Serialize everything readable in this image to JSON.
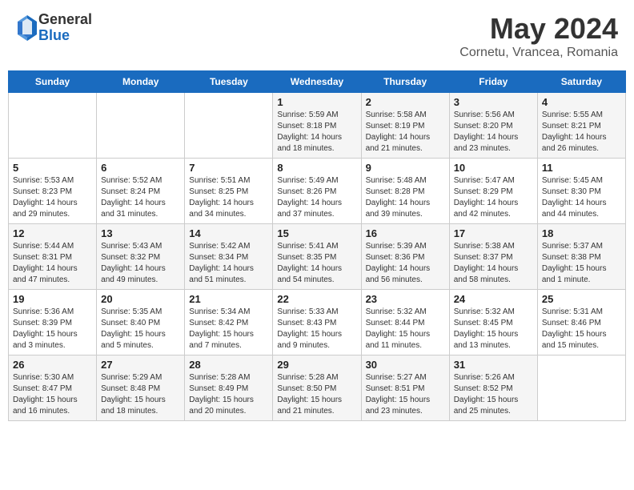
{
  "header": {
    "logo_general": "General",
    "logo_blue": "Blue",
    "month_title": "May 2024",
    "location": "Cornetu, Vrancea, Romania"
  },
  "weekdays": [
    "Sunday",
    "Monday",
    "Tuesday",
    "Wednesday",
    "Thursday",
    "Friday",
    "Saturday"
  ],
  "weeks": [
    [
      {
        "day": "",
        "info": ""
      },
      {
        "day": "",
        "info": ""
      },
      {
        "day": "",
        "info": ""
      },
      {
        "day": "1",
        "info": "Sunrise: 5:59 AM\nSunset: 8:18 PM\nDaylight: 14 hours\nand 18 minutes."
      },
      {
        "day": "2",
        "info": "Sunrise: 5:58 AM\nSunset: 8:19 PM\nDaylight: 14 hours\nand 21 minutes."
      },
      {
        "day": "3",
        "info": "Sunrise: 5:56 AM\nSunset: 8:20 PM\nDaylight: 14 hours\nand 23 minutes."
      },
      {
        "day": "4",
        "info": "Sunrise: 5:55 AM\nSunset: 8:21 PM\nDaylight: 14 hours\nand 26 minutes."
      }
    ],
    [
      {
        "day": "5",
        "info": "Sunrise: 5:53 AM\nSunset: 8:23 PM\nDaylight: 14 hours\nand 29 minutes."
      },
      {
        "day": "6",
        "info": "Sunrise: 5:52 AM\nSunset: 8:24 PM\nDaylight: 14 hours\nand 31 minutes."
      },
      {
        "day": "7",
        "info": "Sunrise: 5:51 AM\nSunset: 8:25 PM\nDaylight: 14 hours\nand 34 minutes."
      },
      {
        "day": "8",
        "info": "Sunrise: 5:49 AM\nSunset: 8:26 PM\nDaylight: 14 hours\nand 37 minutes."
      },
      {
        "day": "9",
        "info": "Sunrise: 5:48 AM\nSunset: 8:28 PM\nDaylight: 14 hours\nand 39 minutes."
      },
      {
        "day": "10",
        "info": "Sunrise: 5:47 AM\nSunset: 8:29 PM\nDaylight: 14 hours\nand 42 minutes."
      },
      {
        "day": "11",
        "info": "Sunrise: 5:45 AM\nSunset: 8:30 PM\nDaylight: 14 hours\nand 44 minutes."
      }
    ],
    [
      {
        "day": "12",
        "info": "Sunrise: 5:44 AM\nSunset: 8:31 PM\nDaylight: 14 hours\nand 47 minutes."
      },
      {
        "day": "13",
        "info": "Sunrise: 5:43 AM\nSunset: 8:32 PM\nDaylight: 14 hours\nand 49 minutes."
      },
      {
        "day": "14",
        "info": "Sunrise: 5:42 AM\nSunset: 8:34 PM\nDaylight: 14 hours\nand 51 minutes."
      },
      {
        "day": "15",
        "info": "Sunrise: 5:41 AM\nSunset: 8:35 PM\nDaylight: 14 hours\nand 54 minutes."
      },
      {
        "day": "16",
        "info": "Sunrise: 5:39 AM\nSunset: 8:36 PM\nDaylight: 14 hours\nand 56 minutes."
      },
      {
        "day": "17",
        "info": "Sunrise: 5:38 AM\nSunset: 8:37 PM\nDaylight: 14 hours\nand 58 minutes."
      },
      {
        "day": "18",
        "info": "Sunrise: 5:37 AM\nSunset: 8:38 PM\nDaylight: 15 hours\nand 1 minute."
      }
    ],
    [
      {
        "day": "19",
        "info": "Sunrise: 5:36 AM\nSunset: 8:39 PM\nDaylight: 15 hours\nand 3 minutes."
      },
      {
        "day": "20",
        "info": "Sunrise: 5:35 AM\nSunset: 8:40 PM\nDaylight: 15 hours\nand 5 minutes."
      },
      {
        "day": "21",
        "info": "Sunrise: 5:34 AM\nSunset: 8:42 PM\nDaylight: 15 hours\nand 7 minutes."
      },
      {
        "day": "22",
        "info": "Sunrise: 5:33 AM\nSunset: 8:43 PM\nDaylight: 15 hours\nand 9 minutes."
      },
      {
        "day": "23",
        "info": "Sunrise: 5:32 AM\nSunset: 8:44 PM\nDaylight: 15 hours\nand 11 minutes."
      },
      {
        "day": "24",
        "info": "Sunrise: 5:32 AM\nSunset: 8:45 PM\nDaylight: 15 hours\nand 13 minutes."
      },
      {
        "day": "25",
        "info": "Sunrise: 5:31 AM\nSunset: 8:46 PM\nDaylight: 15 hours\nand 15 minutes."
      }
    ],
    [
      {
        "day": "26",
        "info": "Sunrise: 5:30 AM\nSunset: 8:47 PM\nDaylight: 15 hours\nand 16 minutes."
      },
      {
        "day": "27",
        "info": "Sunrise: 5:29 AM\nSunset: 8:48 PM\nDaylight: 15 hours\nand 18 minutes."
      },
      {
        "day": "28",
        "info": "Sunrise: 5:28 AM\nSunset: 8:49 PM\nDaylight: 15 hours\nand 20 minutes."
      },
      {
        "day": "29",
        "info": "Sunrise: 5:28 AM\nSunset: 8:50 PM\nDaylight: 15 hours\nand 21 minutes."
      },
      {
        "day": "30",
        "info": "Sunrise: 5:27 AM\nSunset: 8:51 PM\nDaylight: 15 hours\nand 23 minutes."
      },
      {
        "day": "31",
        "info": "Sunrise: 5:26 AM\nSunset: 8:52 PM\nDaylight: 15 hours\nand 25 minutes."
      },
      {
        "day": "",
        "info": ""
      }
    ]
  ]
}
